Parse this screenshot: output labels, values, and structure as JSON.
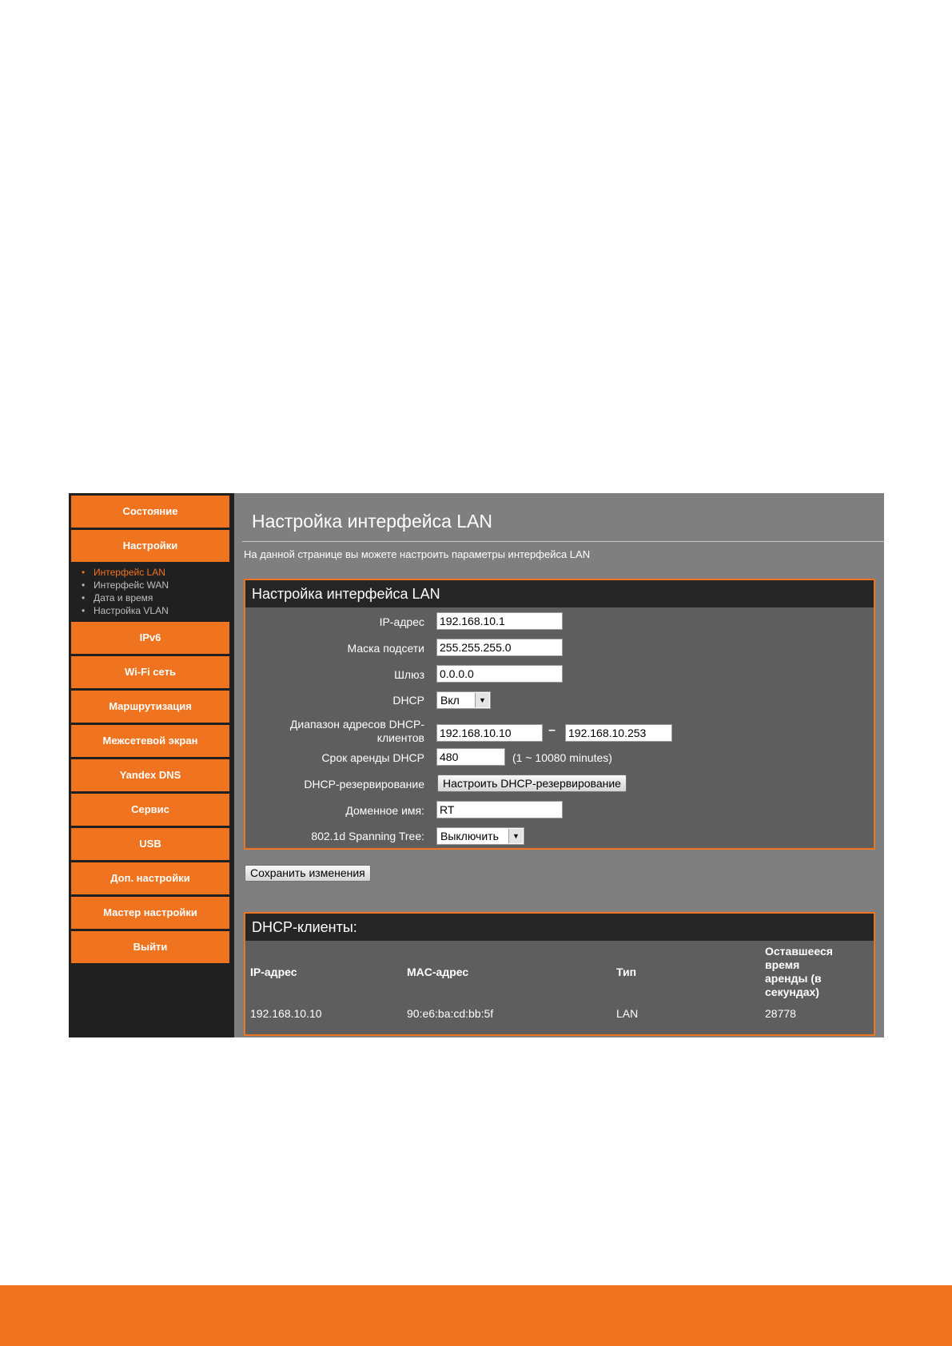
{
  "sidebar": {
    "nav_top": [
      "Состояние",
      "Настройки"
    ],
    "submenu": [
      "Интерфейс LAN",
      "Интерфейс WAN",
      "Дата и время",
      "Настройка VLAN"
    ],
    "nav_bottom": [
      "IPv6",
      "Wi-Fi сеть",
      "Маршрутизация",
      "Межсетевой экран",
      "Yandex DNS",
      "Сервис",
      "USB",
      "Доп. настройки",
      "Мастер настройки",
      "Выйти"
    ]
  },
  "page": {
    "title": "Настройка интерфейса LAN",
    "description": "На данной странице вы можете настроить параметры интерфейса LAN"
  },
  "lan_form": {
    "heading": "Настройка интерфейса LAN",
    "ip_label": "IP-адрес",
    "ip_value": "192.168.10.1",
    "mask_label": "Маска подсети",
    "mask_value": "255.255.255.0",
    "gateway_label": "Шлюз",
    "gateway_value": "0.0.0.0",
    "dhcp_label": "DHCP",
    "dhcp_value": "Вкл",
    "range_label_1": "Диапазон адресов DHCP-",
    "range_label_2": "клиентов",
    "range_start": "192.168.10.10",
    "range_sep": "–",
    "range_end": "192.168.10.253",
    "lease_label": "Срок аренды DHCP",
    "lease_value": "480",
    "lease_hint": "(1 ~ 10080 minutes)",
    "reservation_label": "DHCP-резервирование",
    "reservation_button": "Настроить DHCP-резервирование",
    "domain_label": "Доменное имя:",
    "domain_value": "RT",
    "stp_label": "802.1d Spanning Tree:",
    "stp_value": "Выключить"
  },
  "save_button": "Сохранить изменения",
  "dhcp_clients": {
    "heading": "DHCP-клиенты:",
    "columns": [
      "IP-адрес",
      "MAC-адрес",
      "Тип",
      "Оставшееся время аренды (в секундах)"
    ],
    "rows": [
      [
        "192.168.10.10",
        "90:e6:ba:cd:bb:5f",
        "LAN",
        "28778"
      ]
    ]
  },
  "colors": {
    "accent": "#f07320",
    "sidebar_bg": "#202020",
    "content_bg": "#7f7f7f",
    "panel_bg": "#5e5e5e",
    "panel_head_bg": "#262626"
  }
}
